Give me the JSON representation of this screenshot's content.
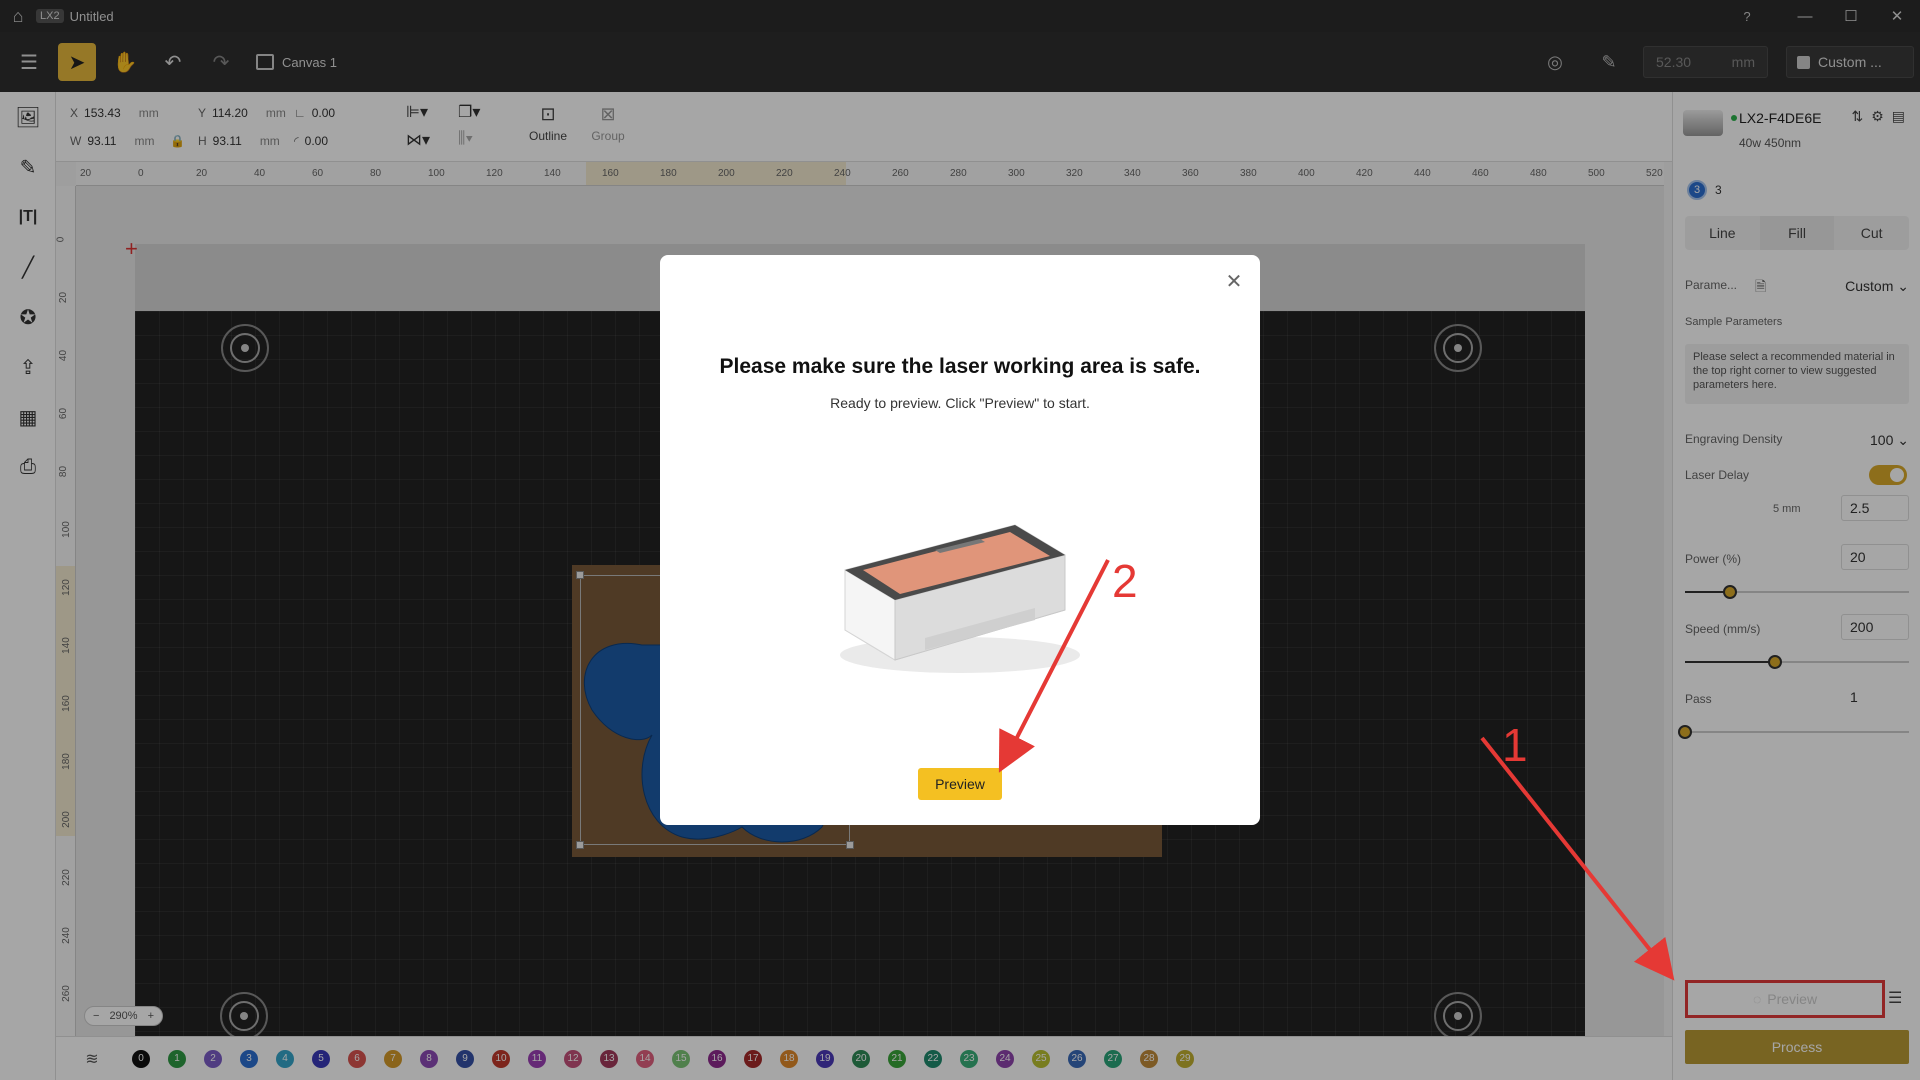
{
  "titlebar": {
    "app_badge": "LX2",
    "doc_title": "Untitled"
  },
  "toolbar": {
    "canvas_tab": "Canvas 1",
    "height_value": "52.30",
    "height_unit": "mm",
    "material_label": "Custom ..."
  },
  "props": {
    "x_label": "X",
    "x_value": "153.43",
    "x_unit": "mm",
    "y_label": "Y",
    "y_value": "114.20",
    "y_unit": "mm",
    "w_label": "W",
    "w_value": "93.11",
    "w_unit": "mm",
    "h_label": "H",
    "h_value": "93.11",
    "h_unit": "mm",
    "angle_value": "0.00",
    "corner_value": "0.00",
    "outline_label": "Outline",
    "group_label": "Group"
  },
  "ruler": {
    "h_ticks": [
      "20",
      "0",
      "20",
      "40",
      "60",
      "80",
      "100",
      "120",
      "140",
      "160",
      "180",
      "200",
      "220",
      "240",
      "260",
      "280",
      "300",
      "320",
      "340",
      "360",
      "380",
      "400",
      "420",
      "440",
      "460",
      "480",
      "500",
      "520"
    ],
    "v_ticks": [
      "0",
      "20",
      "40",
      "60",
      "80",
      "100",
      "120",
      "140",
      "160",
      "180",
      "200",
      "220",
      "240",
      "260"
    ]
  },
  "canvas": {
    "zoom": "290%"
  },
  "layers": {
    "items": [
      {
        "n": "0",
        "color": "#111111"
      },
      {
        "n": "1",
        "color": "#2e9a44"
      },
      {
        "n": "2",
        "color": "#7b5cc6"
      },
      {
        "n": "3",
        "color": "#2c6fd1"
      },
      {
        "n": "4",
        "color": "#35a5c9"
      },
      {
        "n": "5",
        "color": "#3a3ab8"
      },
      {
        "n": "6",
        "color": "#d9534f"
      },
      {
        "n": "7",
        "color": "#d49a2a"
      },
      {
        "n": "8",
        "color": "#8c4bb5"
      },
      {
        "n": "9",
        "color": "#3551a6"
      },
      {
        "n": "10",
        "color": "#c0392b"
      },
      {
        "n": "11",
        "color": "#9b3fb5"
      },
      {
        "n": "12",
        "color": "#c4507a"
      },
      {
        "n": "13",
        "color": "#a23a5b"
      },
      {
        "n": "14",
        "color": "#e0607e"
      },
      {
        "n": "15",
        "color": "#7cc576"
      },
      {
        "n": "16",
        "color": "#8e2a8e"
      },
      {
        "n": "17",
        "color": "#a52a2a"
      },
      {
        "n": "18",
        "color": "#e0892a"
      },
      {
        "n": "19",
        "color": "#4a3ab8"
      },
      {
        "n": "20",
        "color": "#2e8b57"
      },
      {
        "n": "21",
        "color": "#3aa53a"
      },
      {
        "n": "22",
        "color": "#1f8a6e"
      },
      {
        "n": "23",
        "color": "#3ab07a"
      },
      {
        "n": "24",
        "color": "#8e44ad"
      },
      {
        "n": "25",
        "color": "#b8c030"
      },
      {
        "n": "26",
        "color": "#3a6ab8"
      },
      {
        "n": "27",
        "color": "#2aa57a"
      },
      {
        "n": "28",
        "color": "#c08a3a"
      },
      {
        "n": "29",
        "color": "#c0b030"
      }
    ]
  },
  "right_panel": {
    "device_name": "LX2-F4DE6E",
    "device_sub": "40w 450nm",
    "layer_number": "3",
    "layer_label": "3",
    "tabs": [
      "Line",
      "Fill",
      "Cut"
    ],
    "params_label": "Parame...",
    "params_value": "Custom",
    "sample_label": "Sample Parameters",
    "sample_note": "Please select a recommended material in the top right corner to view suggested parameters here.",
    "density_label": "Engraving Density",
    "density_value": "100",
    "laser_delay_label": "Laser Delay",
    "delay_sub_label": "5 mm",
    "delay_value": "2.5",
    "power_label": "Power  (%)",
    "power_value": "20",
    "power_fraction": 0.2,
    "speed_label": "Speed  (mm/s)",
    "speed_value": "200",
    "speed_fraction": 0.4,
    "pass_label": "Pass",
    "pass_value": "1",
    "pass_fraction": 0.0,
    "preview_button": "Preview",
    "process_button": "Process"
  },
  "dialog": {
    "title": "Please make sure the laser working area is safe.",
    "subtitle": "Ready to preview. Click \"Preview\" to start.",
    "preview_button": "Preview"
  },
  "annotations": {
    "one": "1",
    "two": "2",
    "color": "#e53935"
  }
}
